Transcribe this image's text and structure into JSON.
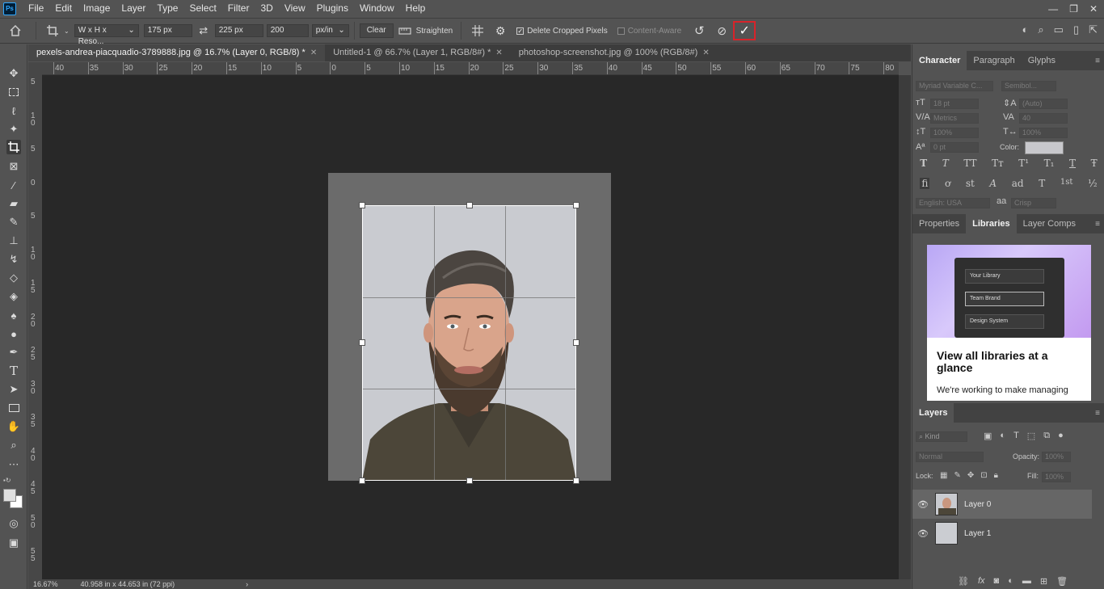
{
  "app": {
    "logo": "Ps"
  },
  "menu": [
    "File",
    "Edit",
    "Image",
    "Layer",
    "Type",
    "Select",
    "Filter",
    "3D",
    "View",
    "Plugins",
    "Window",
    "Help"
  ],
  "window_controls": {
    "minimize": "—",
    "restore": "❐",
    "close": "✕"
  },
  "options": {
    "ratio_preset": "W x H x Reso...",
    "width": "175 px",
    "height": "225 px",
    "resolution": "200",
    "resolution_unit": "px/in",
    "clear_label": "Clear",
    "straighten_label": "Straighten",
    "delete_cropped_label": "Delete Cropped Pixels",
    "delete_cropped_checked": true,
    "content_aware_label": "Content-Aware",
    "content_aware_checked": false,
    "commit_icon": "✓"
  },
  "tabs": [
    {
      "label": "pexels-andrea-piacquadio-3789888.jpg @ 16.7% (Layer 0, RGB/8) *",
      "active": true
    },
    {
      "label": "Untitled-1 @ 66.7% (Layer 1, RGB/8#) *",
      "active": false
    },
    {
      "label": "photoshop-screenshot.jpg @ 100% (RGB/8#)",
      "active": false
    }
  ],
  "ruler": {
    "top_ticks": [
      "40",
      "35",
      "30",
      "25",
      "20",
      "15",
      "10",
      "5",
      "0",
      "5",
      "10",
      "15",
      "20",
      "25",
      "30",
      "35",
      "40",
      "45",
      "50",
      "55",
      "60",
      "65",
      "70",
      "75",
      "80"
    ],
    "left_ticks": [
      "5",
      "1\n0",
      "5",
      "0",
      "5",
      "1\n0",
      "1\n5",
      "2\n0",
      "2\n5",
      "3\n0",
      "3\n5",
      "4\n0",
      "4\n5",
      "5\n0",
      "5\n5"
    ]
  },
  "status": {
    "zoom": "16.67%",
    "doc_info": "40.958 in x 44.653 in (72 ppi)",
    "arrow": "›"
  },
  "character_panel": {
    "tabs": [
      "Character",
      "Paragraph",
      "Glyphs"
    ],
    "font_family": "Myriad Variable C...",
    "font_style": "Semibol...",
    "font_size": "18 pt",
    "leading": "(Auto)",
    "kerning": "Metrics",
    "tracking": "40",
    "vertical_scale": "100%",
    "horizontal_scale": "100%",
    "baseline_shift": "0 pt",
    "color_label": "Color:",
    "color": "#c8c8cc",
    "language": "English: USA",
    "aa_label": "aa",
    "antialias": "Crisp",
    "style_buttons": [
      "T",
      "T",
      "TT",
      "Tт",
      "T¹",
      "T₁",
      "T",
      "Ŧ"
    ],
    "opentype_buttons": [
      "fi",
      "ơ",
      "st",
      "A",
      "ad",
      "T",
      "1st",
      "½"
    ]
  },
  "libraries_panel": {
    "tabs": [
      "Properties",
      "Libraries",
      "Layer Comps"
    ],
    "card_items": [
      "Your Library",
      "Team Brand",
      "Design System"
    ],
    "card_title": "View all libraries at a glance",
    "card_text": "We're working to make managing"
  },
  "layers_panel": {
    "title": "Layers",
    "search_placeholder": "Kind",
    "blend_mode": "Normal",
    "opacity_label": "Opacity:",
    "opacity": "100%",
    "lock_label": "Lock:",
    "fill_label": "Fill:",
    "fill": "100%",
    "layers": [
      {
        "name": "Layer 0",
        "selected": true
      },
      {
        "name": "Layer 1",
        "selected": false
      }
    ],
    "footer_icons": [
      "link-icon",
      "fx-icon",
      "mask-icon",
      "adjustment-icon",
      "group-icon",
      "new-layer-icon",
      "trash-icon"
    ]
  },
  "colors": {
    "accent_commit_border": "#d8232a",
    "canvas_bg": "#282828",
    "ui_bg": "#535353"
  }
}
